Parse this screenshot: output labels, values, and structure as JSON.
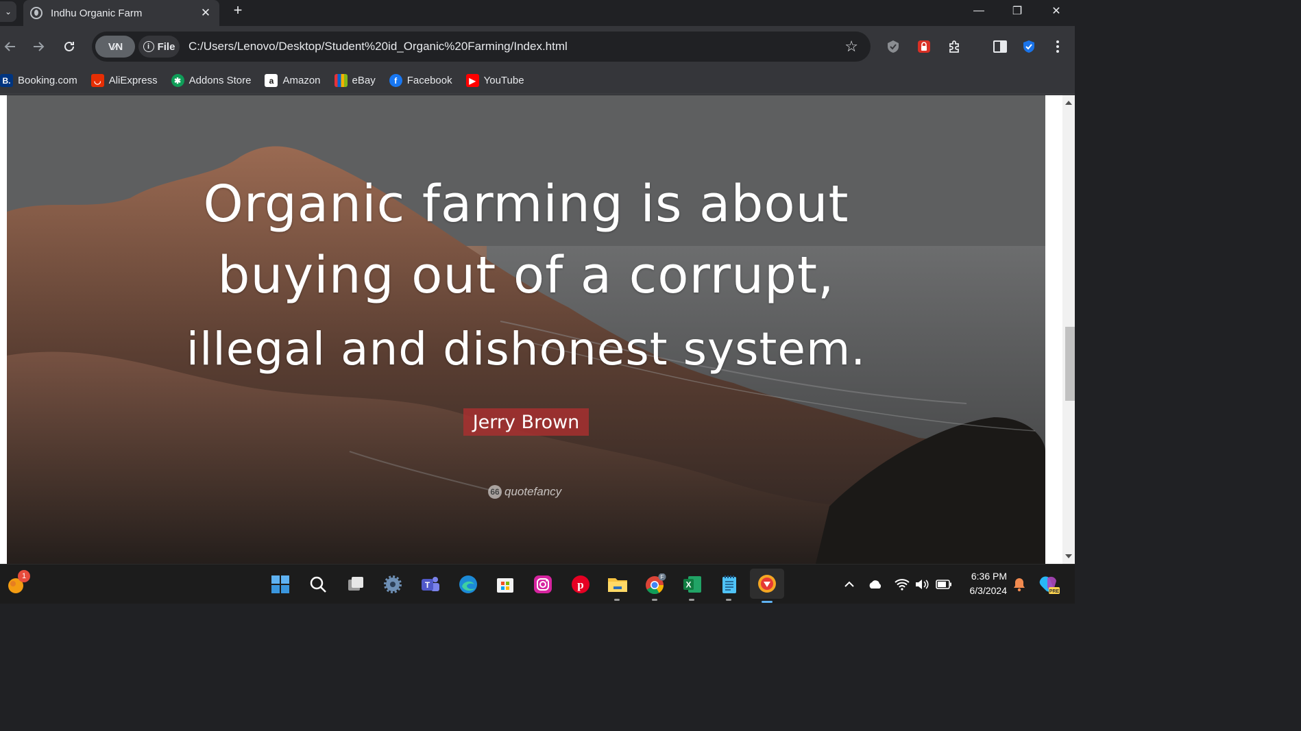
{
  "browser": {
    "tab": {
      "title": "Indhu Organic Farm"
    },
    "new_tab_symbol": "+",
    "window_controls": {
      "minimize": "—",
      "restore": "❐",
      "close": "✕"
    }
  },
  "toolbar": {
    "vpn_label": "V⁄N",
    "site_info_label": "File",
    "url": "C:/Users/Lenovo/Desktop/Student%20id_Organic%20Farming/Index.html"
  },
  "bookmarks": [
    {
      "label": "Booking.com",
      "icon": "booking-icon",
      "icon_text": "B.",
      "color": "#003580"
    },
    {
      "label": "AliExpress",
      "icon": "aliexpress-icon",
      "icon_text": "◡",
      "color": "#e62e04"
    },
    {
      "label": "Addons Store",
      "icon": "addons-store-icon",
      "icon_text": "✱",
      "color": "#0f9d58"
    },
    {
      "label": "Amazon",
      "icon": "amazon-icon",
      "icon_text": "a",
      "color": "#ffffff"
    },
    {
      "label": "eBay",
      "icon": "ebay-icon",
      "icon_text": "",
      "color": "#e53238"
    },
    {
      "label": "Facebook",
      "icon": "facebook-icon",
      "icon_text": "f",
      "color": "#1877f2"
    },
    {
      "label": "YouTube",
      "icon": "youtube-icon",
      "icon_text": "▶",
      "color": "#ff0000"
    }
  ],
  "page": {
    "quote_lines": [
      "Organic farming is about",
      "buying out of a corrupt,",
      "illegal and dishonest system."
    ],
    "author": "Jerry Brown",
    "watermark": "quotefancy",
    "watermark_icon_text": "66"
  },
  "taskbar": {
    "notification_count": "1",
    "apps": [
      {
        "name": "start",
        "icon": "windows-start-icon"
      },
      {
        "name": "search",
        "icon": "search-icon"
      },
      {
        "name": "task-view",
        "icon": "task-view-icon"
      },
      {
        "name": "settings",
        "icon": "settings-icon"
      },
      {
        "name": "teams",
        "icon": "teams-icon"
      },
      {
        "name": "edge",
        "icon": "edge-icon"
      },
      {
        "name": "store",
        "icon": "microsoft-store-icon"
      },
      {
        "name": "instagram",
        "icon": "instagram-icon"
      },
      {
        "name": "pinterest",
        "icon": "pinterest-icon"
      },
      {
        "name": "file-explorer",
        "icon": "file-explorer-icon"
      },
      {
        "name": "chrome",
        "icon": "chrome-icon"
      },
      {
        "name": "excel",
        "icon": "excel-icon"
      },
      {
        "name": "notepad",
        "icon": "notepad-icon"
      },
      {
        "name": "browser-active",
        "icon": "vpn-browser-icon"
      }
    ],
    "chrome_profile_letter": "F",
    "excel_letter": "X",
    "clock": {
      "time": "6:36 PM",
      "date": "6/3/2024"
    },
    "copilot_badge": "PRE"
  },
  "colors": {
    "author_badge": "#aa3030",
    "taskbar_bg": "#1c1c1c",
    "active_indicator": "#5fb2f2"
  }
}
